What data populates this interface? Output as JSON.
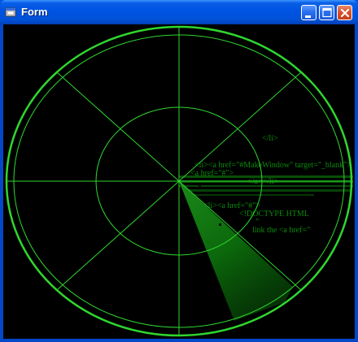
{
  "window": {
    "title": "Form",
    "icon": "app-window-icon",
    "controls": {
      "minimize_icon": "minimize-icon",
      "maximize_icon": "maximize-icon",
      "close_icon": "close-icon"
    }
  },
  "radar": {
    "background": "#000000",
    "line_color": "#2fd62f",
    "sweep_color": "#0a9a0a",
    "blip_color": "#0b0b0b",
    "overlay_text": [
      "</li>",
      "<li><a href=\"#MakeWindow\" target=\"_blank\">",
      "<a href=\"#\">",
      "</a></li>",
      "<!DOCTYPE HTML",
      "<li><a href=\"#\">",
      "\"",
      "link the <a href=\""
    ]
  }
}
